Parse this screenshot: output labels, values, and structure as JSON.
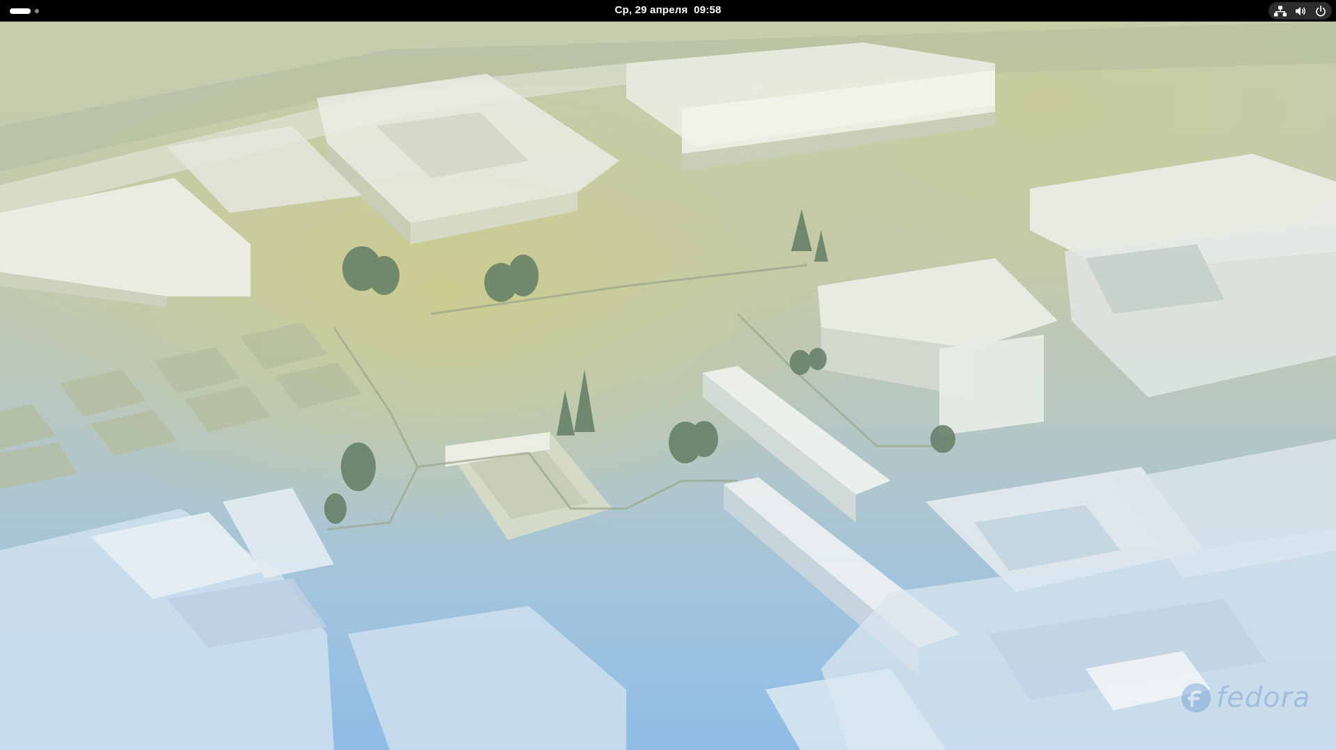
{
  "top_bar": {
    "clock": "Ср, 29 апреля  09:58",
    "activities_icon": "workspace-indicator-icon",
    "status_icons": [
      "network-wired-icon",
      "volume-icon",
      "power-icon"
    ]
  },
  "wallpaper": {
    "scene": "isometric-city-blocks",
    "colors": {
      "top_tint": "#c9cca8",
      "bottom_tint": "#8fbde6",
      "buildings": "#eef0ea",
      "trees": "#5f7a63"
    },
    "logo_text": "fedora"
  }
}
